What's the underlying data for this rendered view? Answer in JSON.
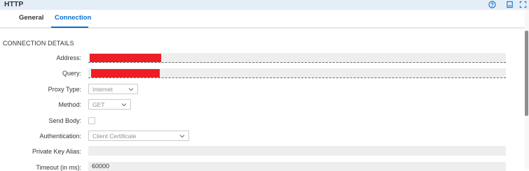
{
  "window": {
    "title": "HTTP",
    "icons": [
      "help-icon",
      "minimize-icon",
      "expand-icon"
    ]
  },
  "tabs": [
    {
      "label": "General",
      "active": false
    },
    {
      "label": "Connection",
      "active": true
    }
  ],
  "section": {
    "title": "CONNECTION DETAILS"
  },
  "fields": {
    "address": {
      "label": "Address:"
    },
    "query": {
      "label": "Query:"
    },
    "proxy_type": {
      "label": "Proxy Type:",
      "value": "Internet"
    },
    "method": {
      "label": "Method:",
      "value": "GET"
    },
    "send_body": {
      "label": "Send Body:",
      "checked": false
    },
    "authentication": {
      "label": "Authentication:",
      "value": "Client Certificate"
    },
    "private_key_alias": {
      "label": "Private Key Alias:",
      "value": ""
    },
    "timeout": {
      "label": "Timeout (in ms):",
      "value": "60000"
    }
  },
  "colors": {
    "accent": "#0a6ed1",
    "redaction": "#ee1c24",
    "titlebar": "#e5eef6"
  }
}
